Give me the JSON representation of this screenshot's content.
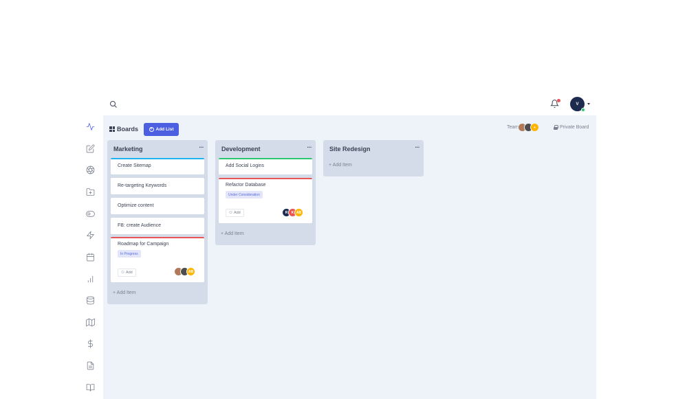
{
  "sidebar": {
    "items": [
      {
        "icon": "activity-icon",
        "active": true
      },
      {
        "icon": "edit-icon"
      },
      {
        "icon": "aperture-icon"
      },
      {
        "icon": "folder-plus-icon"
      },
      {
        "icon": "toggle-icon"
      },
      {
        "icon": "zap-icon"
      },
      {
        "icon": "calendar-icon"
      },
      {
        "icon": "bar-chart-icon"
      },
      {
        "icon": "database-icon"
      },
      {
        "icon": "map-icon"
      },
      {
        "icon": "dollar-icon"
      },
      {
        "icon": "file-text-icon"
      },
      {
        "icon": "book-icon"
      }
    ]
  },
  "topbar": {
    "user_initial": "V"
  },
  "header": {
    "boards_label": "Boards",
    "add_list_label": "Add List",
    "team_label": "Team",
    "team_extra": "+",
    "privacy_label": "Private Board"
  },
  "lists": [
    {
      "title": "Marketing",
      "add_item": "+ Add Item",
      "cards": [
        {
          "title": "Create Sitemap",
          "bar_color": "#1fb2f0"
        },
        {
          "title": "Re-targeting Keywords"
        },
        {
          "title": "Optimize content"
        },
        {
          "title": "FB: create Audience"
        },
        {
          "title": "Roadmap for Campaign",
          "bar_color": "#ea5455",
          "badge": "In Progress",
          "add_label": "Add"
        }
      ]
    },
    {
      "title": "Development",
      "add_item": "+ Add Item",
      "cards": [
        {
          "title": "Add Social Logins",
          "bar_color": "#28c76f"
        },
        {
          "title": "Refactor Database",
          "bar_color": "#ea5455",
          "badge": "Under Consideration",
          "add_label": "Add",
          "avatars": [
            "R",
            "K",
            "AB"
          ]
        }
      ]
    },
    {
      "title": "Site Redesign",
      "add_item": "+ Add Item",
      "cards": []
    }
  ],
  "card_avatars_marketing": [
    "",
    "",
    "AB"
  ],
  "colors": {
    "accent": "#4b5fe0",
    "background": "#eef2f9",
    "list": "#d4dcea"
  }
}
